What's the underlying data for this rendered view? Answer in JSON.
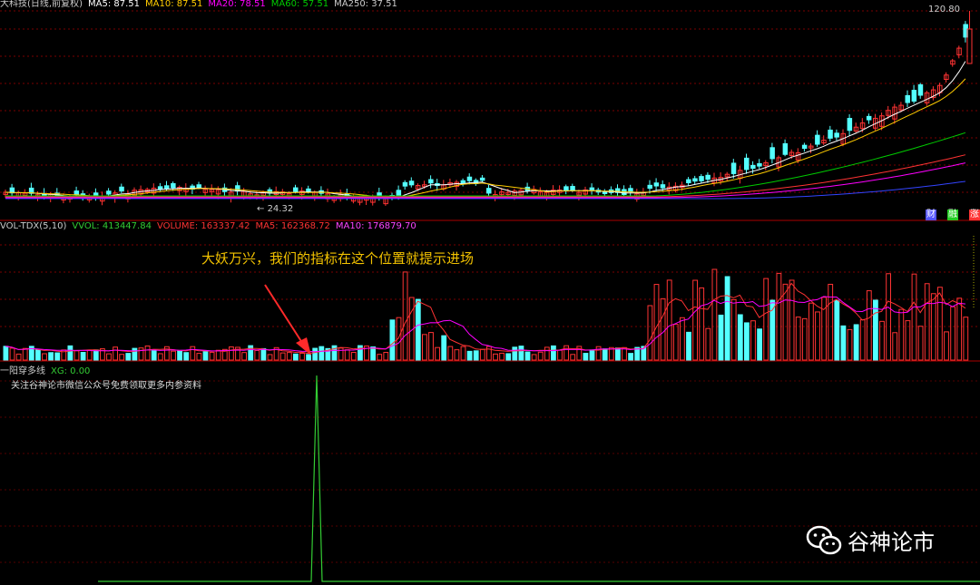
{
  "main_panel": {
    "header_items": [
      {
        "text": "大科技(日线,前复权)",
        "color": "#cccccc"
      },
      {
        "text": "MA5: 87.51",
        "color": "#ffffff"
      },
      {
        "text": "MA10: 87.51",
        "color": "#ffcc00"
      },
      {
        "text": "MA20: 78.51",
        "color": "#ff00ff"
      },
      {
        "text": "MA60: 57.51",
        "color": "#00cc00"
      },
      {
        "text": "MA250: 37.51",
        "color": "#cccccc"
      }
    ],
    "price_high_label": "120.80",
    "price_low_label": "24.32",
    "badges": [
      {
        "text": "财",
        "color": "#5555ff"
      },
      {
        "text": "融",
        "color": "#22cc22"
      },
      {
        "text": "涨",
        "color": "#ff3333"
      }
    ]
  },
  "volume_panel": {
    "header_items": [
      {
        "text": "VOL-TDX(5,10)",
        "color": "#cccccc"
      },
      {
        "text": "VVOL: 413447.84",
        "color": "#33cc33"
      },
      {
        "text": "VOLUME: 163337.42",
        "color": "#ff3333"
      },
      {
        "text": "MA5: 162368.72",
        "color": "#ff3333"
      },
      {
        "text": "MA10: 176879.70",
        "color": "#ff44ff"
      }
    ],
    "annotation": "大妖万兴，我们的指标在这个位置就提示进场"
  },
  "indicator_panel": {
    "header_items": [
      {
        "text": "一阳穿多线",
        "color": "#cccccc"
      },
      {
        "text": "XG: 0.00",
        "color": "#33cc33"
      }
    ],
    "note": "关注谷神论市微信公众号免费领取更多内参资料"
  },
  "watermark": {
    "text": "谷神论市",
    "icon": "wechat-icon"
  },
  "colors": {
    "up": "#ff3333",
    "down": "#54ffff",
    "ma_white": "#ffffff",
    "ma_yellow": "#ffcc00",
    "ma_magenta": "#ff00ff",
    "ma_green": "#00cc00",
    "ma_blue": "#3344ff",
    "signal": "#33cc33",
    "grid": "#7a0000"
  }
}
